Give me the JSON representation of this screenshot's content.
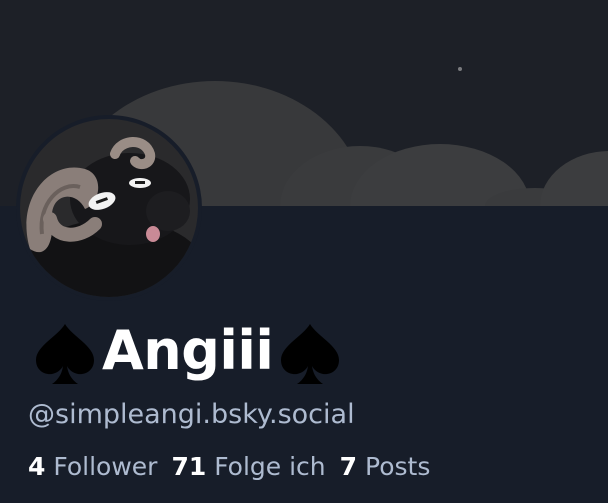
{
  "profile": {
    "display_name": "Angiii",
    "name_decoration": "spade-icon",
    "handle": "@simpleangi.bsky.social"
  },
  "stats": {
    "followers_count": "4",
    "followers_label": "Follower",
    "following_count": "71",
    "following_label": "Folge ich",
    "posts_count": "7",
    "posts_label": "Posts"
  },
  "colors": {
    "page_background": "#171d29",
    "banner_background": "#1c1f26",
    "cloud": "#3a3b3d",
    "text_primary": "#ffffff",
    "text_secondary": "#aebbd0"
  },
  "icons": {
    "avatar": "black-ram-avatar"
  }
}
